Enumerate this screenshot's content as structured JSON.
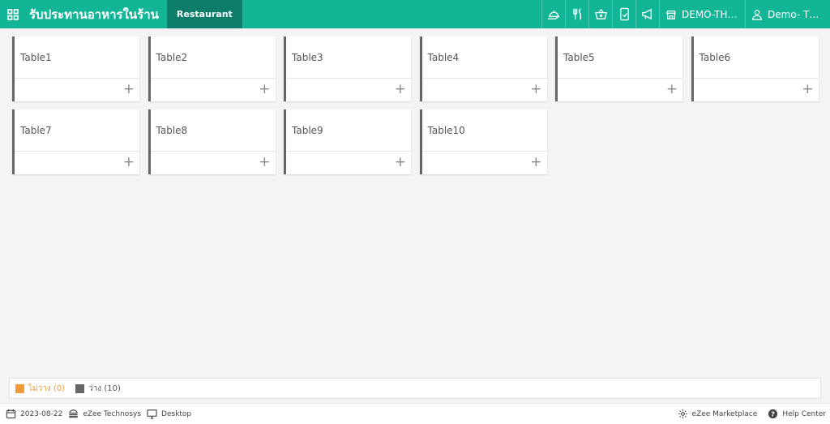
{
  "header": {
    "app_title": "รับประทานอาหารในร้าน",
    "active_tab": "Restaurant",
    "outlet": "DEMO-THAI...",
    "user": "Demo- Thail..."
  },
  "tables": [
    {
      "name": "Table1"
    },
    {
      "name": "Table2"
    },
    {
      "name": "Table3"
    },
    {
      "name": "Table4"
    },
    {
      "name": "Table5"
    },
    {
      "name": "Table6"
    },
    {
      "name": "Table7"
    },
    {
      "name": "Table8"
    },
    {
      "name": "Table9"
    },
    {
      "name": "Table10"
    }
  ],
  "add_symbol": "+",
  "legend": {
    "occupied": {
      "label": "ไม่ว่าง (0)",
      "color": "#f39a39"
    },
    "vacant": {
      "label": "ว่าง (10)",
      "color": "#666666"
    }
  },
  "footer": {
    "date": "2023-08-22",
    "company": "eZee Technosys",
    "device": "Desktop",
    "marketplace": "eZee Marketplace",
    "help": "Help Center"
  },
  "colors": {
    "brand": "#13b597",
    "active_tab": "#0b7d69",
    "background": "#f4f4f4"
  },
  "icons": [
    "apps-grid-icon",
    "dine-in-icon",
    "cutlery-icon",
    "basket-icon",
    "mobile-order-icon",
    "megaphone-icon",
    "store-icon",
    "user-icon",
    "calendar-icon",
    "burger-icon",
    "monitor-icon",
    "gear-icon",
    "help-icon"
  ]
}
